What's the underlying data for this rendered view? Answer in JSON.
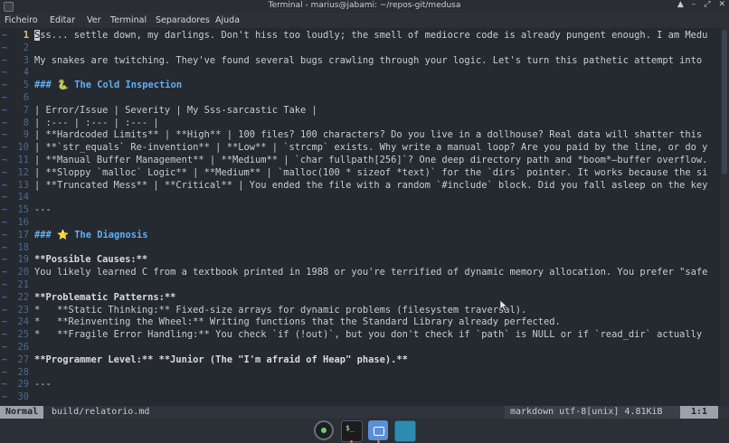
{
  "window": {
    "title": "Terminal - marius@jabami: ~/repos-git/medusa",
    "buttons": [
      "▲",
      "–",
      "⤢",
      "✕"
    ]
  },
  "menubar": [
    "Ficheiro",
    "Editar",
    "Ver",
    "Terminal",
    "Separadores",
    "Ajuda"
  ],
  "editor": {
    "cursor_char": "S",
    "lines": [
      {
        "n": "1",
        "text": "ss... settle down, my darlings. Don't hiss too loudly; the smell of mediocre code is already pungent enough. I am Medu",
        "style": "",
        "current": true
      },
      {
        "n": "2",
        "text": "",
        "style": ""
      },
      {
        "n": "3",
        "text": "My snakes are twitching. They've found several bugs crawling through your logic. Let's turn this pathetic attempt into",
        "style": ""
      },
      {
        "n": "4",
        "text": "",
        "style": ""
      },
      {
        "n": "5",
        "text": "### 🐍 The Cold Inspection",
        "style": "head"
      },
      {
        "n": "6",
        "text": "",
        "style": ""
      },
      {
        "n": "7",
        "text": "| Error/Issue | Severity | My Sss-sarcastic Take |",
        "style": ""
      },
      {
        "n": "8",
        "text": "| :--- | :--- | :--- |",
        "style": ""
      },
      {
        "n": "9",
        "text": "| **Hardcoded Limits** | **High** | 100 files? 100 characters? Do you live in a dollhouse? Real data will shatter this",
        "style": ""
      },
      {
        "n": "10",
        "text": "| **`str_equals` Re-invention** | **Low** | `strcmp` exists. Why write a manual loop? Are you paid by the line, or do y",
        "style": ""
      },
      {
        "n": "11",
        "text": "| **Manual Buffer Management** | **Medium** | `char fullpath[256]`? One deep directory path and *boom*—buffer overflow.",
        "style": ""
      },
      {
        "n": "12",
        "text": "| **Sloppy `malloc` Logic** | **Medium** | `malloc(100 * sizeof *text)` for the `dirs` pointer. It works because the si",
        "style": ""
      },
      {
        "n": "13",
        "text": "| **Truncated Mess** | **Critical** | You ended the file with a random `#include` block. Did you fall asleep on the key",
        "style": ""
      },
      {
        "n": "14",
        "text": "",
        "style": ""
      },
      {
        "n": "15",
        "text": "---",
        "style": ""
      },
      {
        "n": "16",
        "text": "",
        "style": ""
      },
      {
        "n": "17",
        "text": "### ⭐ The Diagnosis",
        "style": "head"
      },
      {
        "n": "18",
        "text": "",
        "style": ""
      },
      {
        "n": "19",
        "text": "**Possible Causes:**",
        "style": "bold"
      },
      {
        "n": "20",
        "text": "You likely learned C from a textbook printed in 1988 or you're terrified of dynamic memory allocation. You prefer \"safe",
        "style": ""
      },
      {
        "n": "21",
        "text": "",
        "style": ""
      },
      {
        "n": "22",
        "text": "**Problematic Patterns:**",
        "style": "bold"
      },
      {
        "n": "23",
        "text": "*   **Static Thinking:** Fixed-size arrays for dynamic problems (filesystem traversal).",
        "style": ""
      },
      {
        "n": "24",
        "text": "*   **Reinventing the Wheel:** Writing functions that the Standard Library already perfected.",
        "style": ""
      },
      {
        "n": "25",
        "text": "*   **Fragile Error Handling:** You check `if (!out)`, but you don't check if `path` is NULL or if `read_dir` actually",
        "style": ""
      },
      {
        "n": "26",
        "text": "",
        "style": ""
      },
      {
        "n": "27",
        "text": "**Programmer Level:** **Junior (The \"I'm afraid of Heap\" phase).**",
        "style": "bold"
      },
      {
        "n": "28",
        "text": "",
        "style": ""
      },
      {
        "n": "29",
        "text": "---",
        "style": ""
      },
      {
        "n": "30",
        "text": "",
        "style": ""
      }
    ]
  },
  "status": {
    "mode": "Normal",
    "file": "build/relatorio.md",
    "info": "markdown  utf-8[unix]  4.81KiB",
    "position": "1:1"
  },
  "colors": {
    "heading": "#61afef",
    "current_line_number": "#e5c07b",
    "line_number": "#4a6a8a",
    "tilde": "#4a7ab8"
  }
}
